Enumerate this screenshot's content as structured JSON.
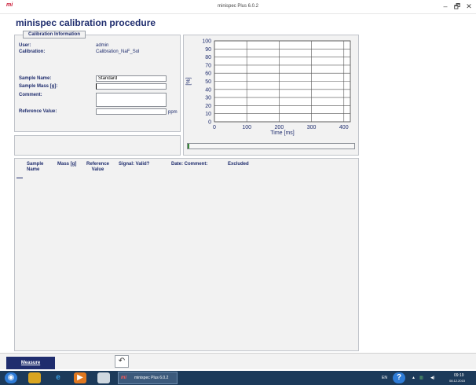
{
  "window": {
    "logo": "mi",
    "title": "minispec Plus 6.0.2",
    "minimize_glyph": "–",
    "maximize_glyph": "🗗",
    "close_glyph": "✕"
  },
  "page": {
    "title": "minispec calibration procedure"
  },
  "calibration_info": {
    "group_label": "Calibration Information",
    "user_label": "User:",
    "user_value": "admin",
    "calibration_label": "Calibration:",
    "calibration_value": "Calibration_NaF_Sol"
  },
  "form": {
    "sample_name_label": "Sample Name:",
    "sample_name_value": "Standard",
    "sample_mass_label": "Sample Mass [g]:",
    "sample_mass_value": "",
    "comment_label": "Comment:",
    "comment_value": "",
    "reference_label": "Reference Value:",
    "reference_value": "",
    "reference_unit": "ppm"
  },
  "chart_data": {
    "type": "line",
    "title": "",
    "xlabel": "Time [ms]",
    "ylabel": "[%]",
    "xlim": [
      0,
      420
    ],
    "ylim": [
      0,
      100
    ],
    "x_ticks": [
      0,
      100,
      200,
      300,
      400
    ],
    "y_ticks": [
      0,
      10,
      20,
      30,
      40,
      50,
      60,
      70,
      80,
      90,
      100
    ],
    "grid": true,
    "series": []
  },
  "progress": {
    "value": 0.01
  },
  "table": {
    "columns": [
      {
        "label": "Sample\nName"
      },
      {
        "label": "Mass [g]"
      },
      {
        "label": "Reference\nValue"
      },
      {
        "label": "Signal: Valid?"
      },
      {
        "label": "Date: Comment:"
      },
      {
        "label": "Excluded"
      }
    ],
    "rows": []
  },
  "toolbar": {
    "measure_label": "Measure",
    "undo_glyph": "↶"
  },
  "taskbar": {
    "start_glyph": "◉",
    "app_logo": "mi",
    "app_label": "minispec Plus 6.0.2",
    "language": "EN",
    "help_glyph": "?",
    "tray_arrow": "▲",
    "time": "09:19",
    "date": "08.12.2015"
  },
  "colors": {
    "label_text": "#1f2d6e",
    "measure_button": "#1f2d6e",
    "taskbar": "#1c3a5a",
    "panel_bg": "#f2f2f2",
    "progress_fill": "#3a8a3a"
  }
}
